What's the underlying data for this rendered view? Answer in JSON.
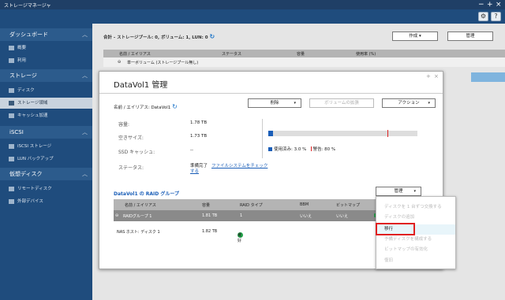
{
  "window": {
    "title": "ストレージマネージャ",
    "controls": [
      "−",
      "+",
      "×"
    ]
  },
  "toolbar": {
    "settings_icon": "gear-icon",
    "help_label": "?"
  },
  "sidebar": {
    "sections": [
      {
        "label": "ダッシュボード",
        "items": [
          "概要",
          "利用"
        ]
      },
      {
        "label": "ストレージ",
        "items": [
          "ディスク",
          "ストレージ領域",
          "キャッシュ加速"
        ]
      },
      {
        "label": "iSCSI",
        "items": [
          "iSCSI ストレージ",
          "LUN バックアップ"
        ]
      },
      {
        "label": "仮想ディスク",
        "items": [
          "リモートディスク",
          "外部デバイス"
        ]
      }
    ],
    "active_item": "ストレージ領域"
  },
  "main": {
    "summary": "合計 - ストレージプール: 0, ボリューム: 1, LUN: 0",
    "create_button": "作成",
    "manage_button": "管理",
    "columns": [
      "名前 / エイリアス",
      "ステータス",
      "容量",
      "使用率 (%)"
    ],
    "row_label": "単一ボリューム (ストレージプール無し)"
  },
  "dialog": {
    "title": "DataVol1 管理",
    "name_label": "名前 / エイリアス: DataVol1",
    "delete_button": "削除",
    "expand_button": "ボリュームの拡張",
    "action_button": "アクション",
    "info": {
      "capacity_label": "容量:",
      "capacity_value": "1.78 TB",
      "free_label": "空きサイズ:",
      "free_value": "1.73 TB",
      "ssd_label": "SSD キャッシュ:",
      "ssd_value": "--",
      "status_label": "ステータス:",
      "status_value": "準備完了",
      "status_action_line1": "する",
      "status_link": "ファイルシステムをチェック"
    },
    "usage": {
      "used_label": "使用済み: 3.0 %",
      "warning_label": "警告: 80 %",
      "used_percent": 3.0,
      "warning_percent": 80
    },
    "raid": {
      "title": "DataVol1 の RAID グループ",
      "manage_button": "管理",
      "columns": [
        "名前 / エイリアス",
        "容量",
        "RAID タイプ",
        "BBM",
        "ビットマップ"
      ],
      "group_row": {
        "name": "RAIDグループ 1",
        "capacity": "1.81 TB",
        "raid_type": "1",
        "bbm": "いいえ",
        "bitmap": "いいえ"
      },
      "disk_row": {
        "name": "NAS ホスト: ディスク 1",
        "capacity": "1.82 TB",
        "status": "良好"
      }
    },
    "menu": {
      "items": [
        {
          "label": "ディスクを 1 台ずつ交換する",
          "enabled": false
        },
        {
          "label": "ディスクの追加",
          "enabled": false
        },
        {
          "label": "移行",
          "enabled": true
        },
        {
          "label": "予備ディスクを構成する",
          "enabled": false
        },
        {
          "label": "ビットマップの有効化",
          "enabled": false
        },
        {
          "label": "復旧",
          "enabled": false
        }
      ]
    }
  },
  "colors": {
    "titlebar": "#1f3f66",
    "sidebar": "#1f4c7d",
    "accent": "#1a5eb8",
    "highlight": "#e02020",
    "ok": "#22a34a"
  }
}
